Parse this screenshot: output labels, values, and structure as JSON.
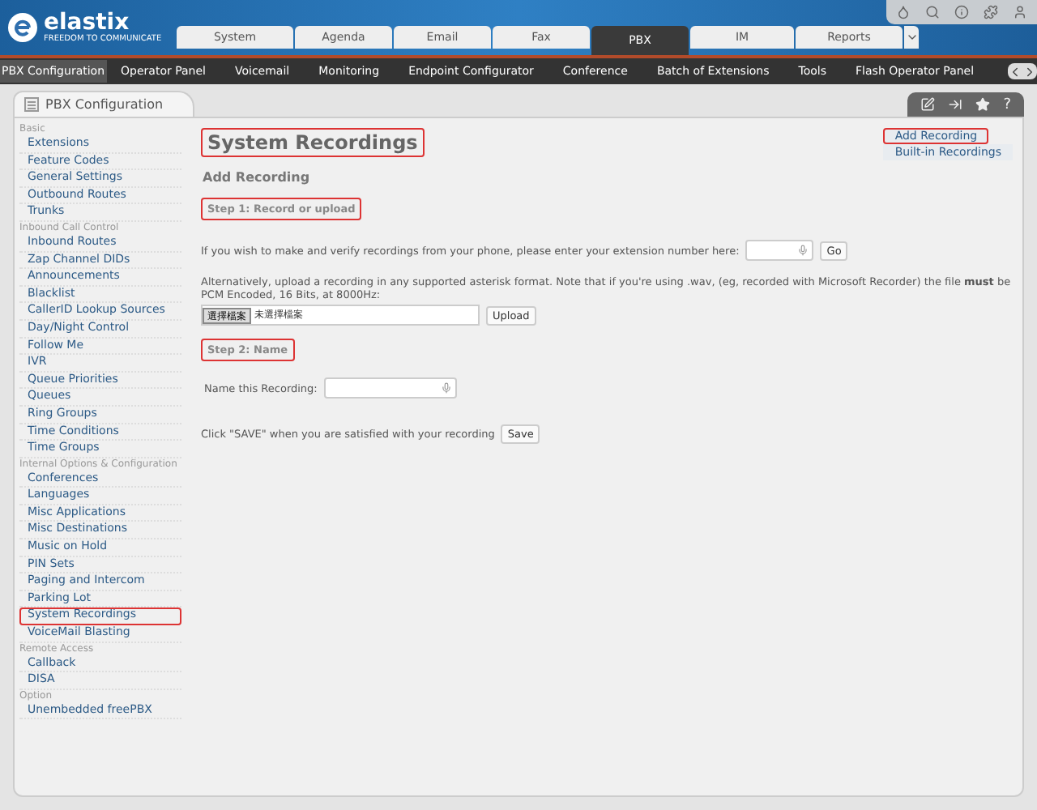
{
  "header": {
    "logo": "elastix",
    "tagline": "FREEDOM TO COMMUNICATE"
  },
  "tabs": [
    {
      "label": "System",
      "selected": false
    },
    {
      "label": "Agenda",
      "selected": false
    },
    {
      "label": "Email",
      "selected": false
    },
    {
      "label": "Fax",
      "selected": false
    },
    {
      "label": "PBX",
      "selected": true
    },
    {
      "label": "IM",
      "selected": false
    },
    {
      "label": "Reports",
      "selected": false
    }
  ],
  "nav": [
    {
      "label": "PBX Configuration",
      "selected": true
    },
    {
      "label": "Operator Panel",
      "selected": false
    },
    {
      "label": "Voicemail",
      "selected": false
    },
    {
      "label": "Monitoring",
      "selected": false
    },
    {
      "label": "Endpoint Configurator",
      "selected": false
    },
    {
      "label": "Conference",
      "selected": false
    },
    {
      "label": "Batch of Extensions",
      "selected": false
    },
    {
      "label": "Tools",
      "selected": false
    },
    {
      "label": "Flash Operator Panel",
      "selected": false
    }
  ],
  "panel": {
    "title": "PBX Configuration",
    "help": "?"
  },
  "sidebar": [
    {
      "heading": "Basic",
      "items": [
        {
          "label": "Extensions",
          "selected": false
        },
        {
          "label": "Feature Codes",
          "selected": false
        },
        {
          "label": "General Settings",
          "selected": false
        },
        {
          "label": "Outbound Routes",
          "selected": false
        },
        {
          "label": "Trunks",
          "selected": false
        }
      ]
    },
    {
      "heading": "Inbound Call Control",
      "items": [
        {
          "label": "Inbound Routes",
          "selected": false
        },
        {
          "label": "Zap Channel DIDs",
          "selected": false
        },
        {
          "label": "Announcements",
          "selected": false
        },
        {
          "label": "Blacklist",
          "selected": false
        },
        {
          "label": "CallerID Lookup Sources",
          "selected": false
        },
        {
          "label": "Day/Night Control",
          "selected": false
        },
        {
          "label": "Follow Me",
          "selected": false
        },
        {
          "label": "IVR",
          "selected": false
        },
        {
          "label": "Queue Priorities",
          "selected": false
        },
        {
          "label": "Queues",
          "selected": false
        },
        {
          "label": "Ring Groups",
          "selected": false
        },
        {
          "label": "Time Conditions",
          "selected": false
        },
        {
          "label": "Time Groups",
          "selected": false
        }
      ]
    },
    {
      "heading": "Internal Options & Configuration",
      "items": [
        {
          "label": "Conferences",
          "selected": false
        },
        {
          "label": "Languages",
          "selected": false
        },
        {
          "label": "Misc Applications",
          "selected": false
        },
        {
          "label": "Misc Destinations",
          "selected": false
        },
        {
          "label": "Music on Hold",
          "selected": false
        },
        {
          "label": "PIN Sets",
          "selected": false
        },
        {
          "label": "Paging and Intercom",
          "selected": false
        },
        {
          "label": "Parking Lot",
          "selected": false
        },
        {
          "label": "System Recordings",
          "selected": true
        },
        {
          "label": "VoiceMail Blasting",
          "selected": false
        }
      ]
    },
    {
      "heading": "Remote Access",
      "items": [
        {
          "label": "Callback",
          "selected": false
        },
        {
          "label": "DISA",
          "selected": false
        }
      ]
    },
    {
      "heading": "Option",
      "items": [
        {
          "label": "Unembedded freePBX",
          "selected": false
        }
      ]
    }
  ],
  "content": {
    "title": {
      "text": "System Recordings",
      "highlighted": true
    },
    "subtitle": "Add Recording",
    "links": [
      {
        "label": "Add Recording",
        "highlighted": true
      },
      {
        "label": "Built-in Recordings",
        "highlighted": false
      }
    ],
    "step1": {
      "text": "Step 1: Record or upload",
      "highlighted": true
    },
    "phone_prompt": "If you wish to make and verify recordings from your phone, please enter your extension number here:",
    "go_button": "Go",
    "upload_note": "Alternatively, upload a recording in any supported asterisk format. Note that if you're using .wav, (eg, recorded with Microsoft Recorder) the file **must** be PCM Encoded, 16 Bits, at 8000Hz:",
    "file_button": "選擇檔案",
    "file_status": "未選擇檔案",
    "upload_button": "Upload",
    "step2": {
      "text": "Step 2: Name",
      "highlighted": true
    },
    "name_label": "Name this Recording:",
    "save_prompt": "Click \"SAVE\" when you are satisfied with your recording",
    "save_button": "Save"
  }
}
